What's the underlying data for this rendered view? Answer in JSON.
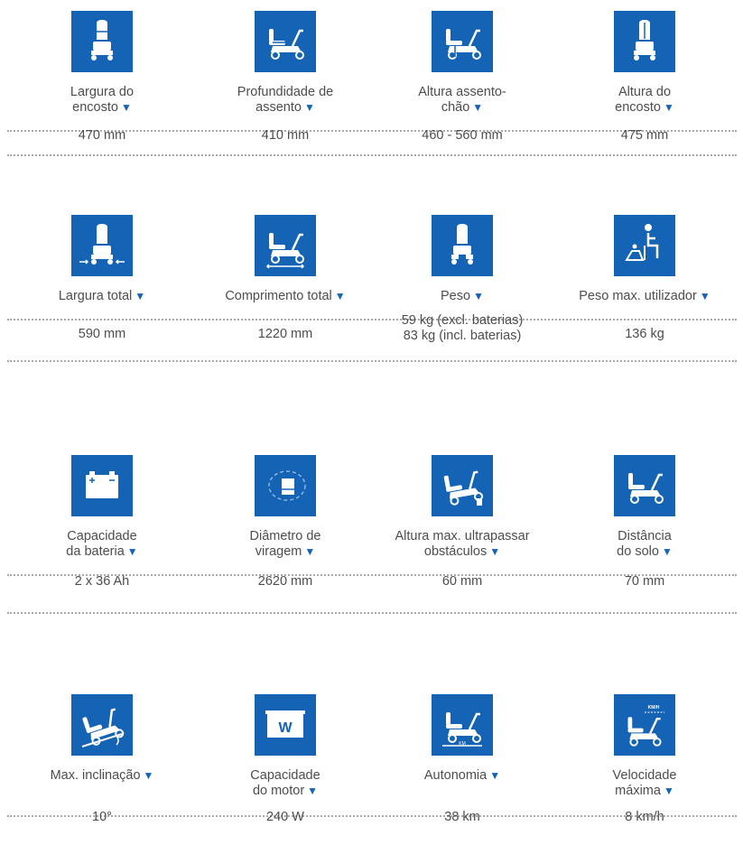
{
  "specs": [
    {
      "icon": "backrest-width-icon",
      "label1": "Largura do",
      "label2": "encosto",
      "value1": "470 mm",
      "value2": ""
    },
    {
      "icon": "seat-depth-icon",
      "label1": "Profundidade de",
      "label2": "assento",
      "value1": "410 mm",
      "value2": ""
    },
    {
      "icon": "seat-height-icon",
      "label1": "Altura assento-",
      "label2": "chão",
      "value1": "460 - 560 mm",
      "value2": ""
    },
    {
      "icon": "backrest-height-icon",
      "label1": "Altura do",
      "label2": "encosto",
      "value1": "475 mm",
      "value2": ""
    },
    {
      "icon": "total-width-icon",
      "label1": "",
      "label2": "Largura total",
      "value1": "590 mm",
      "value2": ""
    },
    {
      "icon": "total-length-icon",
      "label1": "",
      "label2": "Comprimento total",
      "value1": "1220 mm",
      "value2": ""
    },
    {
      "icon": "weight-icon",
      "label1": "",
      "label2": "Peso",
      "value1": "59 kg (excl. baterias)",
      "value2": "83 kg (incl. baterias)"
    },
    {
      "icon": "max-user-weight-icon",
      "label1": "",
      "label2": "Peso max. utilizador",
      "value1": "136 kg",
      "value2": ""
    },
    {
      "icon": "battery-icon",
      "label1": "Capacidade",
      "label2": "da bateria",
      "value1": "2 x 36 Ah",
      "value2": ""
    },
    {
      "icon": "turning-diameter-icon",
      "label1": "Diâmetro de",
      "label2": "viragem",
      "value1": "2620 mm",
      "value2": ""
    },
    {
      "icon": "obstacle-height-icon",
      "label1": "Altura max. ultrapassar",
      "label2": "obstáculos",
      "value1": "60 mm",
      "value2": ""
    },
    {
      "icon": "ground-clearance-icon",
      "label1": "Distância",
      "label2": "do solo",
      "value1": "70 mm",
      "value2": ""
    },
    {
      "icon": "max-incline-icon",
      "label1": "",
      "label2": "Max. inclinação",
      "value1": "10°",
      "value2": ""
    },
    {
      "icon": "motor-capacity-icon",
      "label1": "Capacidade",
      "label2": "do motor",
      "value1": "240 W",
      "value2": ""
    },
    {
      "icon": "range-icon",
      "label1": "",
      "label2": "Autonomia",
      "value1": "38 km",
      "value2": ""
    },
    {
      "icon": "max-speed-icon",
      "label1": "Velocidade",
      "label2": "máxima",
      "value1": "8 km/h",
      "value2": ""
    }
  ],
  "arrow_glyph": "▼",
  "motor_icon_text": "W",
  "range_icon_text": "KM",
  "speed_icon_text": "KM/H",
  "colors": {
    "accent": "#1463b5",
    "text": "#4d4d4d",
    "divider": "#a8a8a8"
  }
}
